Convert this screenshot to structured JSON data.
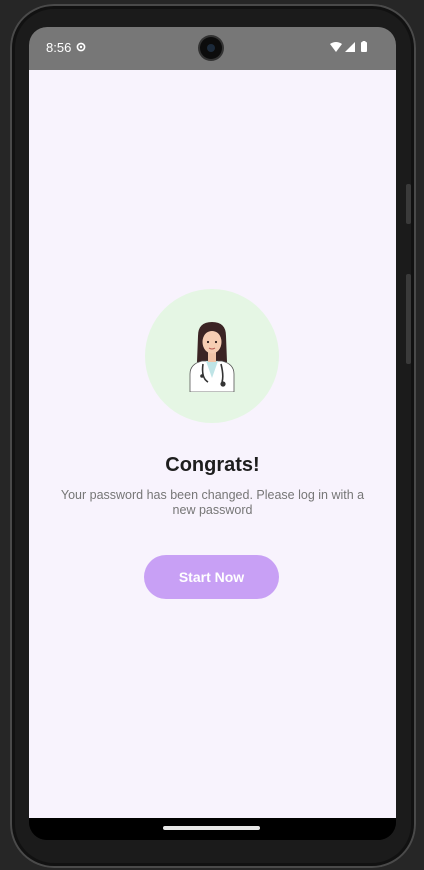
{
  "status_bar": {
    "time": "8:56",
    "settings_icon": "gear-icon",
    "icons": [
      "wifi-icon",
      "signal-icon",
      "battery-icon"
    ]
  },
  "main": {
    "illustration": "doctor-avatar",
    "title": "Congrats!",
    "message": "Your password has been changed. Please log in with a new password",
    "cta_label": "Start Now"
  },
  "colors": {
    "background": "#f8f3fd",
    "avatar_circle": "#e5f6e4",
    "button": "#c8a0f5",
    "status_bar": "#777777"
  }
}
